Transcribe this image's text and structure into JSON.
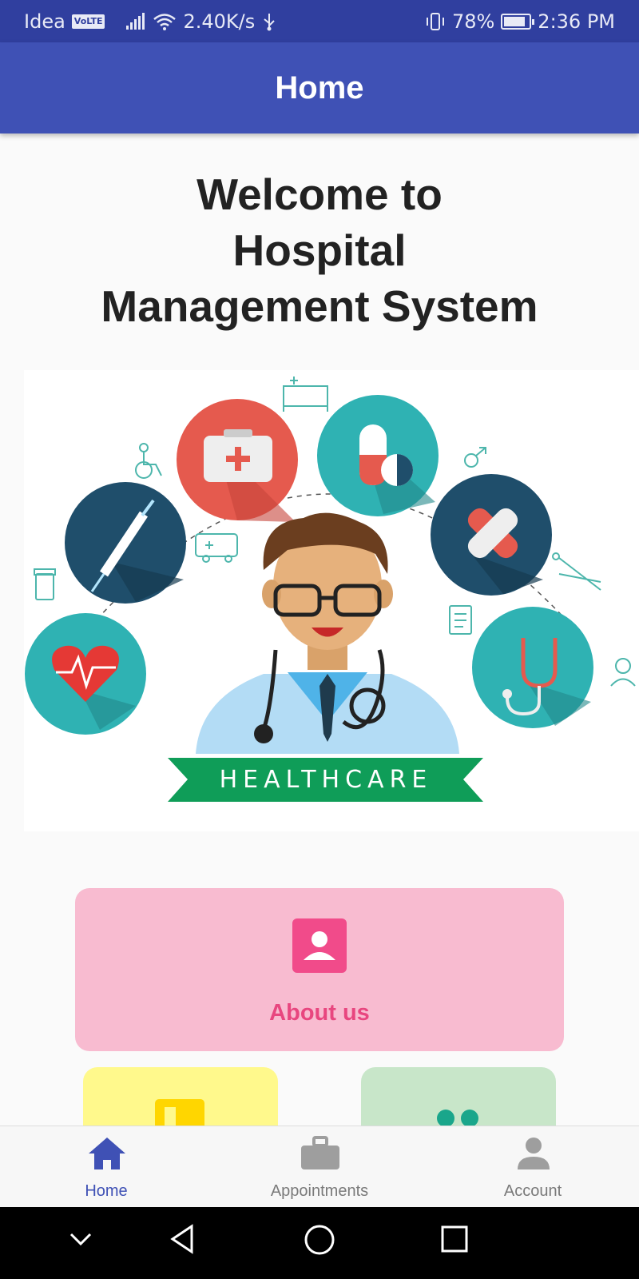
{
  "status_bar": {
    "carrier": "Idea",
    "volte": "VoLTE",
    "speed": "2.40K/s",
    "battery": "78%",
    "time": "2:36 PM"
  },
  "app_bar": {
    "title": "Home"
  },
  "welcome": {
    "text": "Welcome to\nHospital\nManagement System"
  },
  "hero": {
    "banner_text": "HEALTHCARE"
  },
  "cards": {
    "about": {
      "label": "About us",
      "icon": "person-icon"
    }
  },
  "bottom_nav": {
    "items": [
      {
        "label": "Home",
        "icon": "home-icon",
        "active": true
      },
      {
        "label": "Appointments",
        "icon": "briefcase-icon",
        "active": false
      },
      {
        "label": "Account",
        "icon": "person-icon",
        "active": false
      }
    ]
  },
  "colors": {
    "primary": "#3f51b5",
    "primary_dark": "#303f9f",
    "about_card": "#f8bbd0",
    "about_accent": "#f14b8a",
    "yellow_card": "#fff98c",
    "green_card": "#c8e6c9",
    "banner_green": "#0f9d58"
  }
}
